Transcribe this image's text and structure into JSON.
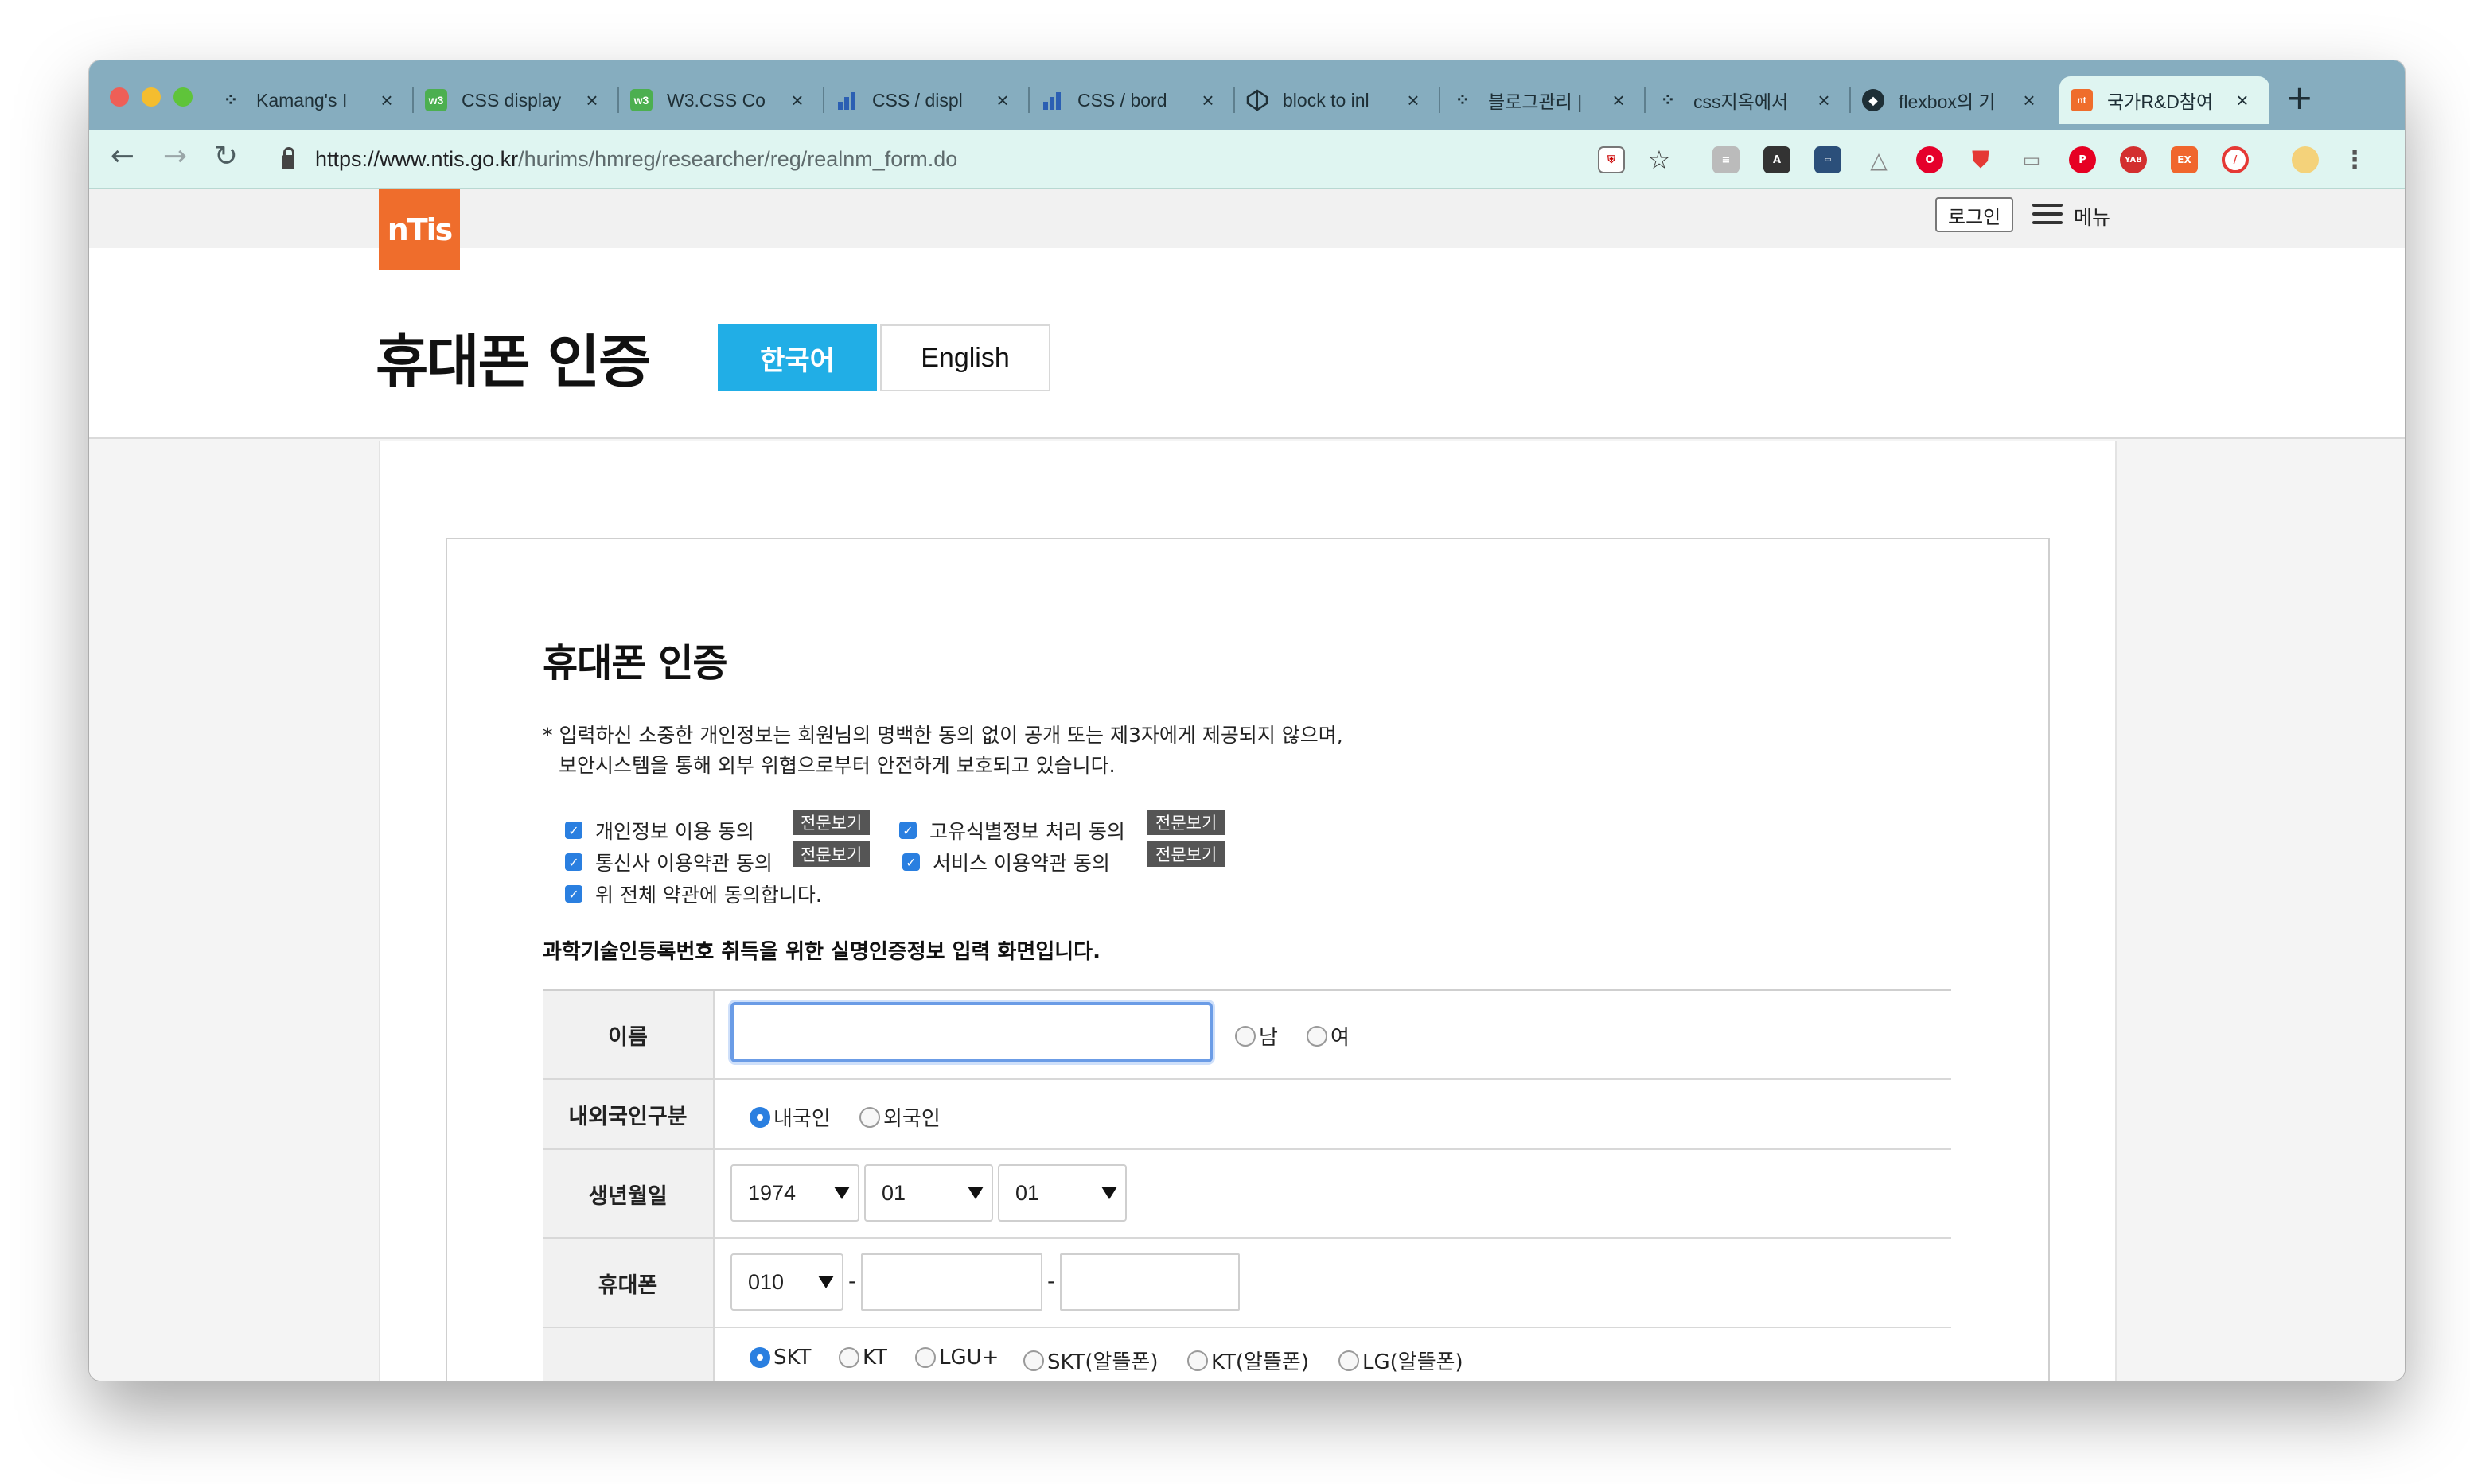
{
  "browser": {
    "tabs": [
      {
        "label": "Kamang's I",
        "icon": "tistory-icon",
        "color": "#1e2f36"
      },
      {
        "label": "CSS display",
        "icon": "w3schools-icon",
        "color": "#4caf50"
      },
      {
        "label": "W3.CSS Co",
        "icon": "w3schools-icon",
        "color": "#4caf50"
      },
      {
        "label": "CSS / displ",
        "icon": "chart-bars-icon",
        "color": "#2b5fb3"
      },
      {
        "label": "CSS / bord",
        "icon": "chart-bars-icon",
        "color": "#2b5fb3"
      },
      {
        "label": "block to inl",
        "icon": "codepen-icon",
        "color": "#1e2f36"
      },
      {
        "label": "블로그관리 |",
        "icon": "tistory-icon",
        "color": "#1e2f36"
      },
      {
        "label": "css지옥에서",
        "icon": "tistory-icon",
        "color": "#1e2f36"
      },
      {
        "label": "flexbox의 기",
        "icon": "bird-icon",
        "color": "#1e2f36"
      },
      {
        "label": "국가R&D참여",
        "icon": "ntis-icon",
        "color": "#ef6d2c"
      }
    ],
    "url": {
      "host": "https://www.ntis.go.kr",
      "path": "/hurims/hmreg/researcher/reg/realnm_form.do"
    },
    "extensions": [
      "translate",
      "A",
      "box",
      "drive",
      "opera",
      "shield",
      "window",
      "pinterest",
      "YAB",
      "EX",
      "block",
      "avatar"
    ]
  },
  "site": {
    "logo_text": "nTis",
    "login_label": "로그인",
    "menu_label": "메뉴",
    "page_title": "휴대폰 인증",
    "lang_ko": "한국어",
    "lang_en": "English"
  },
  "card": {
    "title": "휴대폰 인증",
    "notice_line1": "* 입력하신 소중한 개인정보는 회원님의 명백한 동의 없이 공개 또는 제3자에게 제공되지 않으며,",
    "notice_line2": "보안시스템을 통해 외부 위협으로부터 안전하게 보호되고 있습니다.",
    "agreements": {
      "privacy": "개인정보 이용 동의",
      "unique_id": "고유식별정보 처리 동의",
      "carrier": "통신사 이용약관 동의",
      "service": "서비스 이용약관 동의",
      "all": "위 전체 약관에 동의합니다."
    },
    "view_full": "전문보기",
    "guide": "과학기술인등록번호 취득을 위한 실명인증정보 입력 화면입니다."
  },
  "form": {
    "name": {
      "label": "이름",
      "value": "",
      "gender_male": "남",
      "gender_female": "여"
    },
    "nationality": {
      "label": "내외국인구분",
      "domestic": "내국인",
      "foreign": "외국인"
    },
    "birth": {
      "label": "생년월일",
      "year": "1974",
      "month": "01",
      "day": "01"
    },
    "phone": {
      "label": "휴대폰",
      "prefix": "010",
      "dash": "-"
    },
    "carriers": [
      "SKT",
      "KT",
      "LGU+",
      "SKT(알뜰폰)",
      "KT(알뜰폰)",
      "LG(알뜰폰)"
    ]
  }
}
